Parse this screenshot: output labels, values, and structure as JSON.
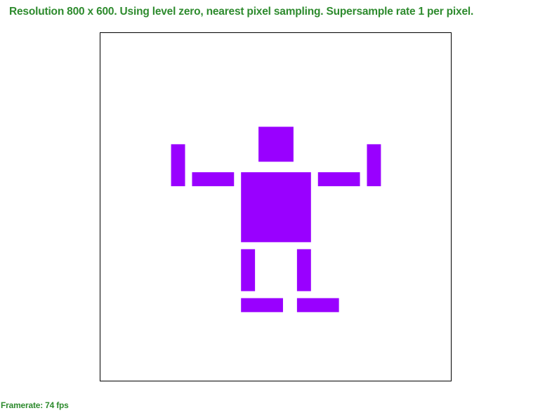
{
  "colors": {
    "status_text": "#2e8b2e",
    "shape_fill": "#9900ff",
    "viewport_border": "#000000",
    "background": "#ffffff"
  },
  "header": {
    "status": "Resolution 800 x 600. Using level zero, nearest pixel sampling. Supersample rate 1 per pixel."
  },
  "footer": {
    "framerate": "Framerate: 74 fps"
  },
  "scene": {
    "figure_parts": [
      "head",
      "torso",
      "left-upper-arm",
      "left-forearm",
      "right-upper-arm",
      "right-forearm",
      "left-thigh",
      "right-thigh",
      "left-foot",
      "right-foot"
    ]
  }
}
